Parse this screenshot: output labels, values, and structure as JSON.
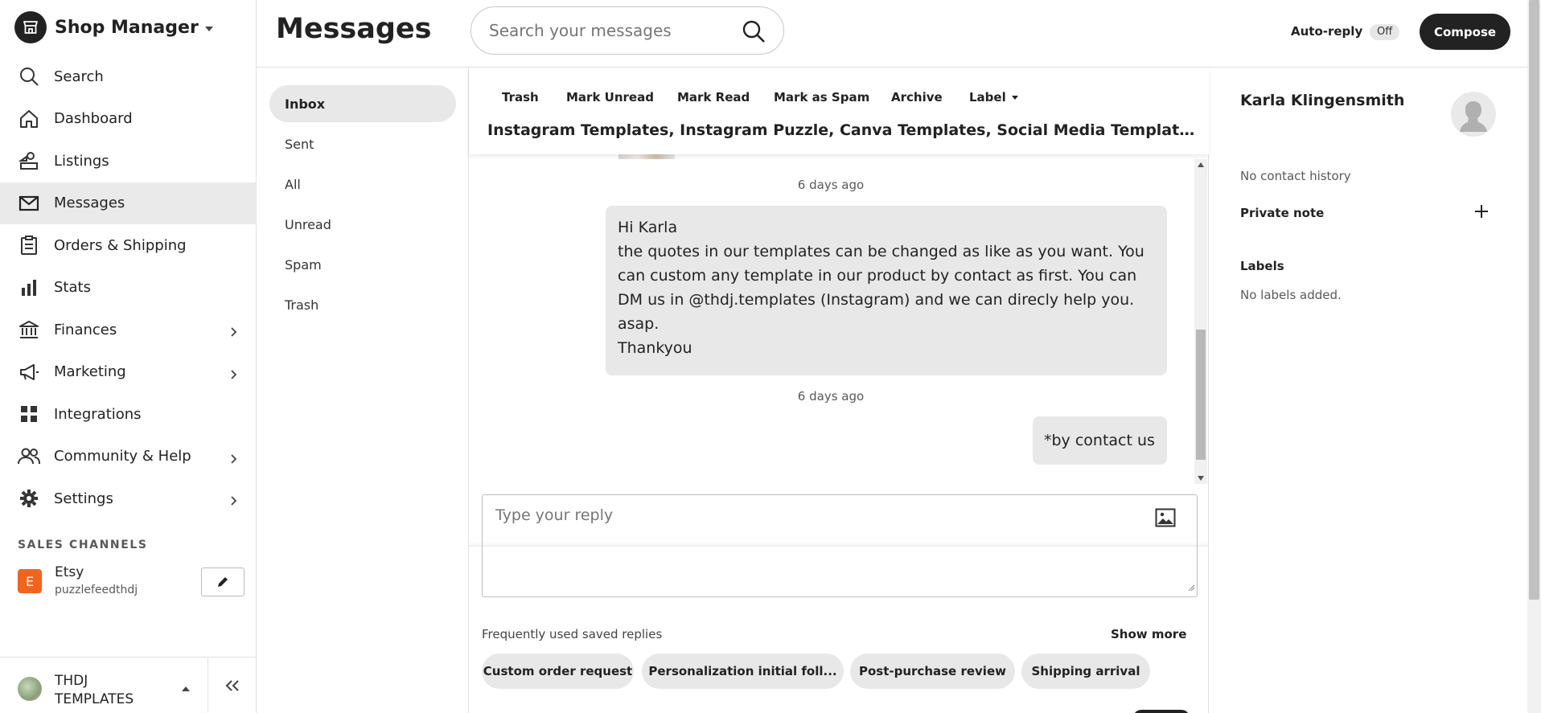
{
  "sidebar": {
    "brand": "Shop Manager",
    "items": [
      {
        "label": "Search",
        "icon": "search-icon",
        "chevron": false,
        "active": false
      },
      {
        "label": "Dashboard",
        "icon": "home-icon",
        "chevron": false,
        "active": false
      },
      {
        "label": "Listings",
        "icon": "listings-icon",
        "chevron": false,
        "active": false
      },
      {
        "label": "Messages",
        "icon": "envelope-icon",
        "chevron": false,
        "active": true
      },
      {
        "label": "Orders & Shipping",
        "icon": "clipboard-icon",
        "chevron": false,
        "active": false
      },
      {
        "label": "Stats",
        "icon": "bar-chart-icon",
        "chevron": false,
        "active": false
      },
      {
        "label": "Finances",
        "icon": "bank-icon",
        "chevron": true,
        "active": false
      },
      {
        "label": "Marketing",
        "icon": "megaphone-icon",
        "chevron": true,
        "active": false
      },
      {
        "label": "Integrations",
        "icon": "grid-icon",
        "chevron": false,
        "active": false
      },
      {
        "label": "Community & Help",
        "icon": "people-icon",
        "chevron": true,
        "active": false
      },
      {
        "label": "Settings",
        "icon": "gear-icon",
        "chevron": true,
        "active": false
      }
    ],
    "channels_heading": "SALES CHANNELS",
    "channel": {
      "badge": "E",
      "name": "Etsy",
      "shop": "puzzlefeedthdj"
    },
    "account": {
      "name": "THDJ TEMPLATES"
    }
  },
  "header": {
    "title": "Messages",
    "search_placeholder": "Search your messages",
    "autoreply_label": "Auto-reply",
    "autoreply_state": "Off",
    "compose_label": "Compose"
  },
  "folders": [
    {
      "label": "Inbox",
      "active": true
    },
    {
      "label": "Sent",
      "active": false
    },
    {
      "label": "All",
      "active": false
    },
    {
      "label": "Unread",
      "active": false
    },
    {
      "label": "Spam",
      "active": false
    },
    {
      "label": "Trash",
      "active": false
    }
  ],
  "conversation": {
    "actions": {
      "trash": "Trash",
      "mark_unread": "Mark Unread",
      "mark_read": "Mark Read",
      "mark_spam": "Mark as Spam",
      "archive": "Archive",
      "label": "Label"
    },
    "subject": "Instagram Templates, Instagram Puzzle, Canva Templates, Social Media Template, Instag...",
    "messages": [
      {
        "timestamp": "6 days ago",
        "lines": [
          "Hi Karla",
          "the quotes in our templates can be changed as like as you want. You",
          "can custom any template in our product by contact as first. You can",
          "DM us in @thdj.templates (Instagram) and we can direcly help you.",
          "asap.",
          "Thankyou"
        ]
      },
      {
        "timestamp": "6 days ago",
        "lines": [
          "*by contact us"
        ]
      }
    ],
    "reply_placeholder": "Type your reply",
    "saved_replies_heading": "Frequently used saved replies",
    "show_more": "Show more",
    "saved_replies": [
      "Custom order request",
      "Personalization initial foll...",
      "Post-purchase review",
      "Shipping arrival"
    ]
  },
  "contact": {
    "name": "Karla Klingensmith",
    "history": "No contact history",
    "private_note_label": "Private note",
    "labels_heading": "Labels",
    "labels_empty": "No labels added."
  },
  "colors": {
    "accent_dark": "#222222",
    "active_bg": "#eaeaea",
    "bubble_bg": "#e8e8e8",
    "etsy_orange": "#f1641e"
  }
}
